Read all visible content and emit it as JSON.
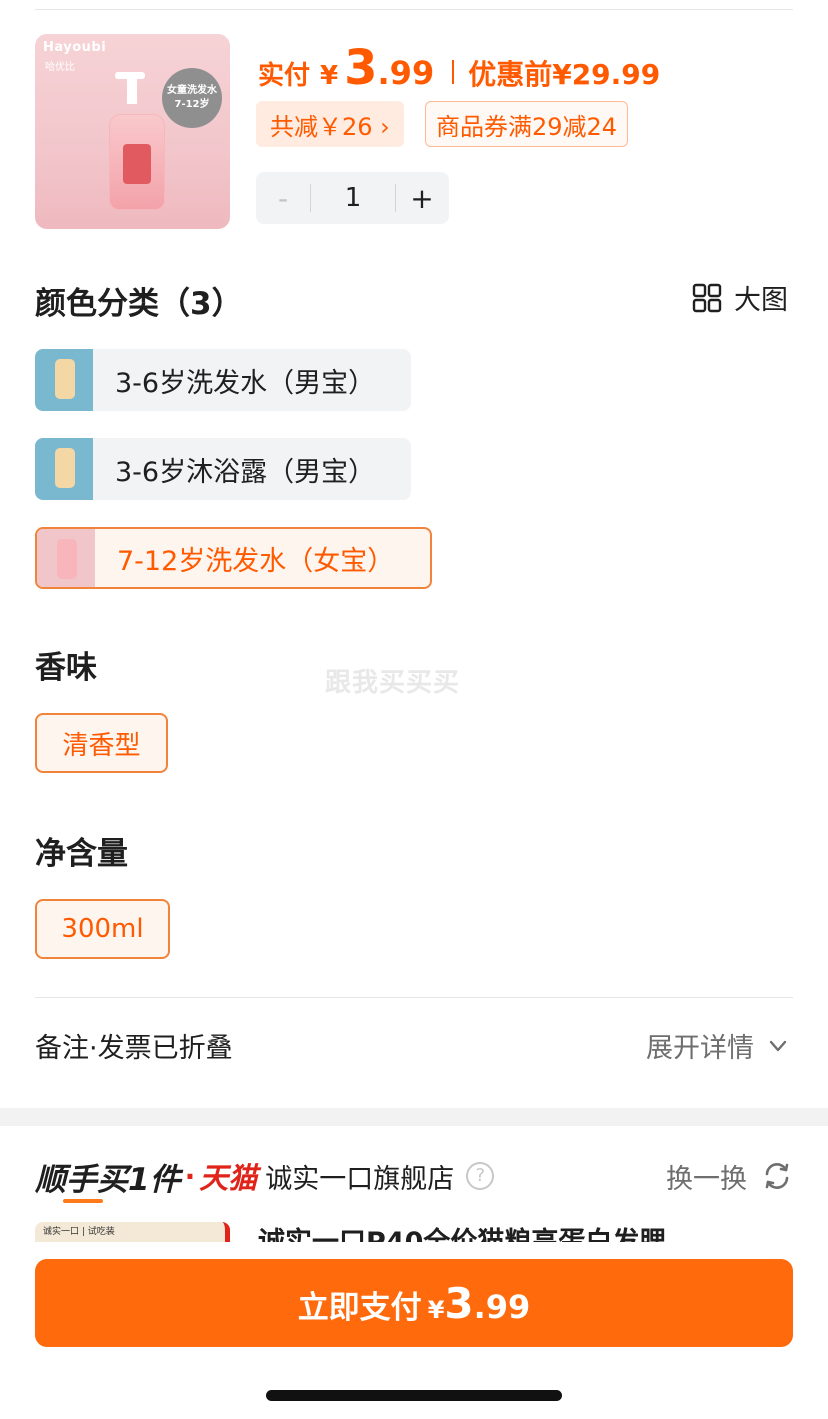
{
  "product": {
    "thumb_brand": "Hayoubi",
    "thumb_brand_cn": "哈优比",
    "thumb_badge_line1": "女童洗发水",
    "thumb_badge_line2": "7-12岁"
  },
  "price": {
    "actual_label": "实付",
    "actual_currency": "¥",
    "actual_int": "3",
    "actual_dec": ".99",
    "original_label": "优惠前",
    "original_value": "¥29.99"
  },
  "discount": {
    "total_label": "共减￥26 ›",
    "coupon_label": "商品券满29减24"
  },
  "quantity": {
    "minus": "-",
    "value": "1",
    "plus": "+"
  },
  "color_section": {
    "title": "颜色分类（3）",
    "big_pic_label": "大图",
    "options": [
      {
        "label": "3-6岁洗发水（男宝）",
        "selected": false
      },
      {
        "label": "3-6岁沐浴露（男宝）",
        "selected": false
      },
      {
        "label": "7-12岁洗发水（女宝）",
        "selected": true
      }
    ]
  },
  "scent_section": {
    "title": "香味",
    "option": "清香型"
  },
  "volume_section": {
    "title": "净含量",
    "option": "300ml"
  },
  "watermark": "跟我买买买",
  "remark": {
    "text": "备注·发票已折叠",
    "expand_label": "展开详情"
  },
  "shunshou": {
    "title": "顺手买1件",
    "dot": "·",
    "platform": "天猫",
    "store": "诚实一口旗舰店",
    "help": "?",
    "swap_label": "换一换",
    "upsell_img_text": "诚实一口 | 试吃装",
    "upsell_name": "诚实一口P40全价猫粮高蛋白发腮"
  },
  "pay_button": {
    "label": "立即支付",
    "currency": "¥",
    "int": "3",
    "dec": ".99"
  },
  "colors": {
    "accent": "#ff5a00",
    "pay_button": "#ff6a0c",
    "tmall_red": "#e0241a"
  }
}
